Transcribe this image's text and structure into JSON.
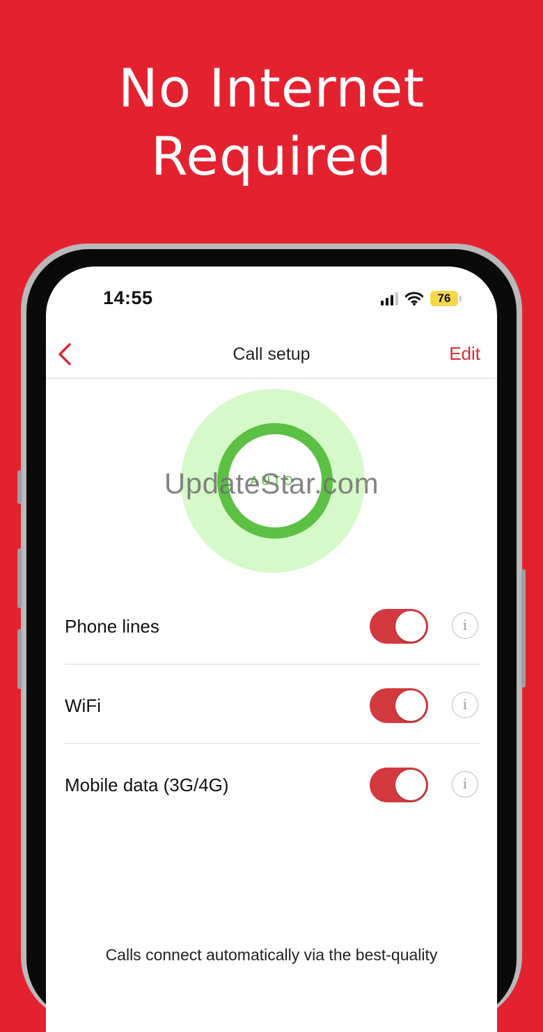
{
  "headline": {
    "line1": "No Internet",
    "line2": "Required"
  },
  "status_bar": {
    "time": "14:55",
    "battery_level": "76",
    "icons": [
      "cellular-signal-icon",
      "wifi-icon",
      "battery-icon"
    ]
  },
  "nav": {
    "title": "Call setup",
    "edit_label": "Edit",
    "back_icon": "chevron-left-icon"
  },
  "auto_indicator": {
    "label": "AUTO"
  },
  "watermark": "UpdateStar.com",
  "settings": [
    {
      "label": "Phone lines",
      "enabled": true
    },
    {
      "label": "WiFi",
      "enabled": true
    },
    {
      "label": "Mobile data (3G/4G)",
      "enabled": true
    }
  ],
  "info_glyph": "i",
  "footer_text": "Calls connect automatically via the best-quality",
  "colors": {
    "brand_red": "#E4222F",
    "toggle_on": "#D23A3F",
    "auto_green": "#5BC043",
    "auto_glow": "#D5F9C8",
    "battery_yellow": "#F6D84A"
  }
}
